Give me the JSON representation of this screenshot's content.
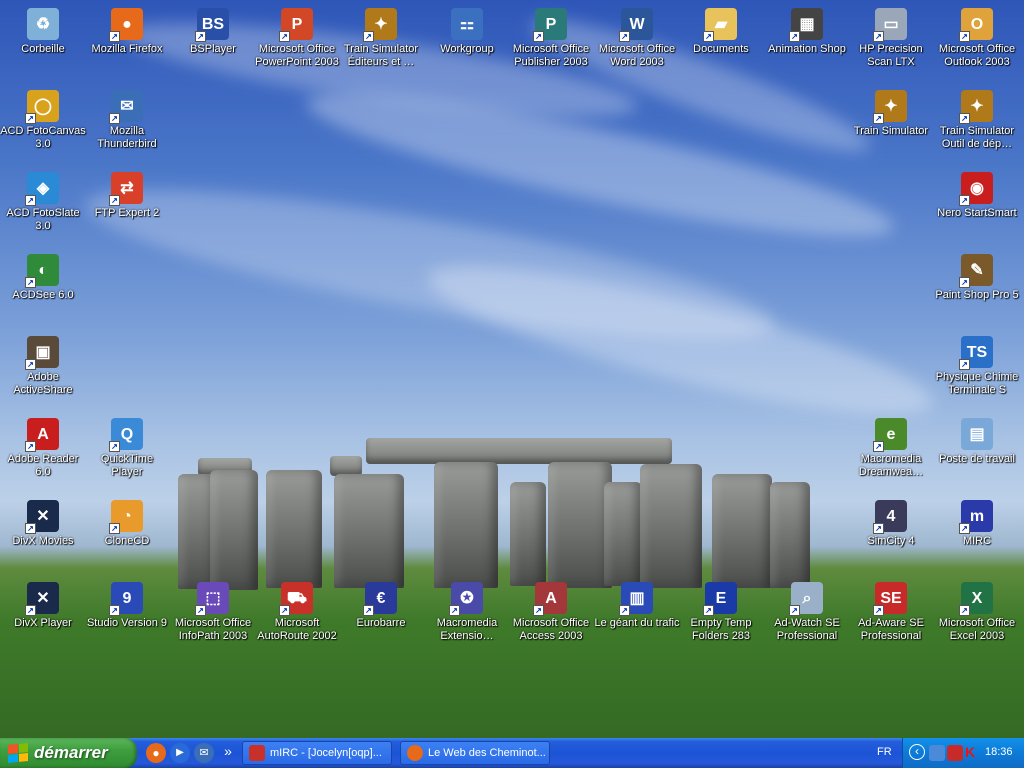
{
  "desktop": {
    "icons": [
      {
        "label": "Corbeille",
        "icon": "recycle-bin-icon",
        "color": "#7fb0d8",
        "glyph": "♻"
      },
      {
        "label": "Mozilla Firefox",
        "icon": "firefox-icon",
        "color": "#e66a1a",
        "glyph": "●"
      },
      {
        "label": "BSPlayer",
        "icon": "bsplayer-icon",
        "color": "#2a4fa8",
        "glyph": "BS"
      },
      {
        "label": "Microsoft Office PowerPoint 2003",
        "icon": "powerpoint-icon",
        "color": "#d24726",
        "glyph": "P"
      },
      {
        "label": "Train Simulator Éditeurs et …",
        "icon": "train-simulator-editor-icon",
        "color": "#b07a1a",
        "glyph": "✦"
      },
      {
        "label": "Workgroup",
        "icon": "network-icon",
        "color": "#3b6fc0",
        "glyph": "⚏"
      },
      {
        "label": "Microsoft Office Publisher 2003",
        "icon": "publisher-icon",
        "color": "#2b7a7a",
        "glyph": "P"
      },
      {
        "label": "Microsoft Office Word 2003",
        "icon": "word-icon",
        "color": "#2b579a",
        "glyph": "W"
      },
      {
        "label": "Documents",
        "icon": "folder-icon",
        "color": "#e8c25a",
        "glyph": "▰"
      },
      {
        "label": "Animation Shop",
        "icon": "animation-shop-icon",
        "color": "#444444",
        "glyph": "▦"
      },
      {
        "label": "HP Precision Scan LTX",
        "icon": "scanner-icon",
        "color": "#9aa7b8",
        "glyph": "▭"
      },
      {
        "label": "Microsoft Office Outlook 2003",
        "icon": "outlook-icon",
        "color": "#e0a23a",
        "glyph": "O"
      },
      {
        "label": "ACD FotoCanvas 3.0",
        "icon": "acd-fotocanvas-icon",
        "color": "#d9a21c",
        "glyph": "◯"
      },
      {
        "label": "Mozilla Thunderbird",
        "icon": "thunderbird-icon",
        "color": "#3a6fb8",
        "glyph": "✉"
      },
      {
        "label": "Train Simulator",
        "icon": "train-simulator-icon",
        "color": "#b07a1a",
        "glyph": "✦"
      },
      {
        "label": "Train Simulator Outil de dép…",
        "icon": "train-simulator-tool-icon",
        "color": "#b07a1a",
        "glyph": "✦"
      },
      {
        "label": "ACD FotoSlate 3.0",
        "icon": "acd-fotoslate-icon",
        "color": "#2a8ad6",
        "glyph": "◈"
      },
      {
        "label": "FTP Expert 2",
        "icon": "ftp-expert-icon",
        "color": "#d8402a",
        "glyph": "⇄"
      },
      {
        "label": "Nero StartSmart",
        "icon": "nero-icon",
        "color": "#c81e1e",
        "glyph": "◉"
      },
      {
        "label": "ACDSee 6.0",
        "icon": "acdsee-icon",
        "color": "#2f8a3a",
        "glyph": "◐"
      },
      {
        "label": "Paint Shop Pro 5",
        "icon": "paint-shop-pro-icon",
        "color": "#7a5a2a",
        "glyph": "✎"
      },
      {
        "label": "Adobe ActiveShare",
        "icon": "adobe-activeshare-icon",
        "color": "#5a4a3a",
        "glyph": "▣"
      },
      {
        "label": "Physique Chimie Terminale S",
        "icon": "physique-chimie-icon",
        "color": "#2a6fc8",
        "glyph": "TS"
      },
      {
        "label": "Adobe Reader 6.0",
        "icon": "adobe-reader-icon",
        "color": "#c81e1e",
        "glyph": "A"
      },
      {
        "label": "QuickTime Player",
        "icon": "quicktime-icon",
        "color": "#3a8ad8",
        "glyph": "Q"
      },
      {
        "label": "Macromedia Dreamwea…",
        "icon": "dreamweaver-icon",
        "color": "#4a8a2a",
        "glyph": "e"
      },
      {
        "label": "Poste de travail",
        "icon": "my-computer-icon",
        "color": "#7aa8d8",
        "glyph": "▤"
      },
      {
        "label": "DivX Movies",
        "icon": "divx-movies-icon",
        "color": "#1a2a4a",
        "glyph": "✕"
      },
      {
        "label": "CloneCD",
        "icon": "clonecd-icon",
        "color": "#e89a2a",
        "glyph": "◔"
      },
      {
        "label": "SimCity 4",
        "icon": "simcity-icon",
        "color": "#3a3a5a",
        "glyph": "4"
      },
      {
        "label": "MIRC",
        "icon": "mirc-icon",
        "color": "#2a3aa8",
        "glyph": "m"
      },
      {
        "label": "DivX Player",
        "icon": "divx-player-icon",
        "color": "#1a2a4a",
        "glyph": "✕"
      },
      {
        "label": "Studio Version 9",
        "icon": "studio-icon",
        "color": "#2a4ab8",
        "glyph": "9"
      },
      {
        "label": "Microsoft Office InfoPath 2003",
        "icon": "infopath-icon",
        "color": "#6a4ab8",
        "glyph": "⬚"
      },
      {
        "label": "Microsoft AutoRoute 2002",
        "icon": "autoroute-icon",
        "color": "#c8302a",
        "glyph": "⛟"
      },
      {
        "label": "Eurobarre",
        "icon": "eurobarre-icon",
        "color": "#2a3a9a",
        "glyph": "€"
      },
      {
        "label": "Macromedia Extensio…",
        "icon": "macromedia-extension-icon",
        "color": "#4a4aa8",
        "glyph": "✪"
      },
      {
        "label": "Microsoft Office Access 2003",
        "icon": "access-icon",
        "color": "#a4373a",
        "glyph": "A"
      },
      {
        "label": "Le géant du trafic",
        "icon": "geant-trafic-icon",
        "color": "#2a4ab8",
        "glyph": "▥"
      },
      {
        "label": "Empty Temp Folders 283",
        "icon": "empty-temp-icon",
        "color": "#1a3aa8",
        "glyph": "E"
      },
      {
        "label": "Ad-Watch SE Professional",
        "icon": "ad-watch-icon",
        "color": "#9ab0c8",
        "glyph": "⌕"
      },
      {
        "label": "Ad-Aware SE Professional",
        "icon": "ad-aware-icon",
        "color": "#c82a2a",
        "glyph": "SE"
      },
      {
        "label": "Microsoft Office Excel 2003",
        "icon": "excel-icon",
        "color": "#217346",
        "glyph": "X"
      }
    ]
  },
  "taskbar": {
    "start_label": "démarrer",
    "quick_launch": [
      {
        "icon": "firefox-icon",
        "color": "#e66a1a",
        "glyph": "●"
      },
      {
        "icon": "media-player-icon",
        "color": "#2a6ad8",
        "glyph": "▶"
      },
      {
        "icon": "thunderbird-icon",
        "color": "#3a6fb8",
        "glyph": "✉"
      }
    ],
    "more_glyph": "»",
    "tasks": [
      {
        "label": "mIRC - [Jocelyn[oqp]...",
        "icon": "mirc-icon",
        "color": "#c8302a"
      },
      {
        "label": "Le Web des Cheminot...",
        "icon": "firefox-icon",
        "color": "#e66a1a"
      }
    ],
    "tray": {
      "language": "FR",
      "collapse_glyph": "‹",
      "icons": [
        {
          "icon": "network-users-icon",
          "color": "#4a8ad8"
        },
        {
          "icon": "antivirus-icon",
          "color": "#c82a2a"
        },
        {
          "icon": "k-icon",
          "color": "#c81e1e",
          "glyph": "K"
        }
      ],
      "clock": "18:36"
    }
  }
}
